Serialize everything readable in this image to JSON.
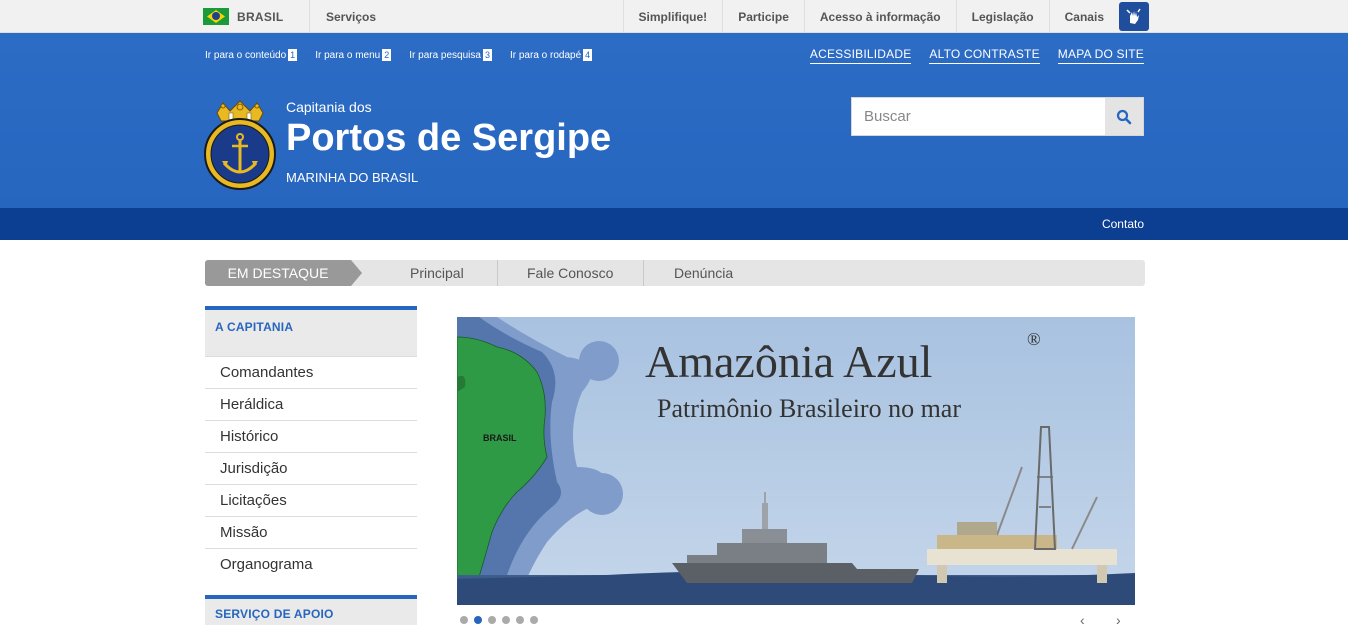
{
  "gov_bar": {
    "country": "BRASIL",
    "services": "Serviços",
    "links": [
      "Simplifique!",
      "Participe",
      "Acesso à informação",
      "Legislação",
      "Canais"
    ],
    "vlibras_icon": "sign-language-icon"
  },
  "accessibility": {
    "skip_links": [
      {
        "label": "Ir para o conteúdo",
        "key": "1"
      },
      {
        "label": "Ir para o menu",
        "key": "2"
      },
      {
        "label": "Ir para pesquisa",
        "key": "3"
      },
      {
        "label": "Ir para o rodapé",
        "key": "4"
      }
    ],
    "right_links": [
      "ACESSIBILIDADE",
      "ALTO CONTRASTE",
      "MAPA DO SITE"
    ]
  },
  "site": {
    "pre_title": "Capitania dos",
    "title": "Portos de Sergipe",
    "subtitle": "MARINHA DO BRASIL",
    "logo_text": "MARINHA DO BRASIL"
  },
  "search": {
    "placeholder": "Buscar",
    "icon": "search-icon"
  },
  "service_bar": {
    "contact": "Contato"
  },
  "tabs": {
    "active": "EM DESTAQUE",
    "items": [
      "Principal",
      "Fale Conosco",
      "Denúncia"
    ]
  },
  "sidebar": {
    "section1": "A CAPITANIA",
    "items": [
      "Comandantes",
      "Heráldica",
      "Histórico",
      "Jurisdição",
      "Licitações",
      "Missão",
      "Organograma"
    ],
    "section2": "SERVIÇO DE APOIO"
  },
  "banner": {
    "title": "Amazônia Azul",
    "registered": "®",
    "subtitle": "Patrimônio Brasileiro no mar",
    "map_label": "BRASIL"
  },
  "carousel": {
    "slide_count": 6,
    "active_index": 1
  },
  "colors": {
    "header_blue": "#2766bf",
    "service_bar_blue": "#0c3e92",
    "accent": "#2766bf"
  }
}
